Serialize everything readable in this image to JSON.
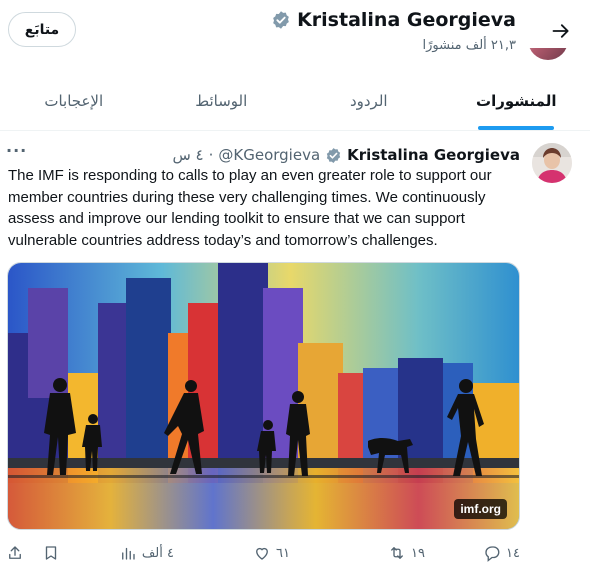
{
  "header": {
    "profile_name": "Kristalina Georgieva",
    "post_count": "٢١,٣ ألف منشورًا",
    "follow_label": "متابَع"
  },
  "tabs": [
    {
      "label": "المنشورات",
      "active": true
    },
    {
      "label": "الردود",
      "active": false
    },
    {
      "label": "الوسائط",
      "active": false
    },
    {
      "label": "الإعجابات",
      "active": false
    }
  ],
  "tweet": {
    "author": "Kristalina Georgieva",
    "handle": "@KGeorgieva",
    "time": "٤ س",
    "separator": "·",
    "more": "···",
    "text": "The IMF is responding to calls to play an even greater role to support our member countries during these very challenging times. We continuously assess and improve our lending toolkit to ensure that we can support vulnerable countries address today’s and tomorrow’s challenges.",
    "media_source": "imf.org",
    "counts": {
      "replies": "١٤",
      "reposts": "١٩",
      "likes": "٦١",
      "views": "٤ ألف"
    }
  },
  "colors": {
    "accent": "#1d9bf0",
    "verified": "#829aab",
    "muted": "#536471",
    "text": "#0f1419"
  },
  "icons": [
    "back-arrow-icon",
    "verified-badge-icon",
    "more-icon",
    "reply-icon",
    "repost-icon",
    "like-icon",
    "views-icon",
    "bookmark-icon",
    "share-icon"
  ]
}
